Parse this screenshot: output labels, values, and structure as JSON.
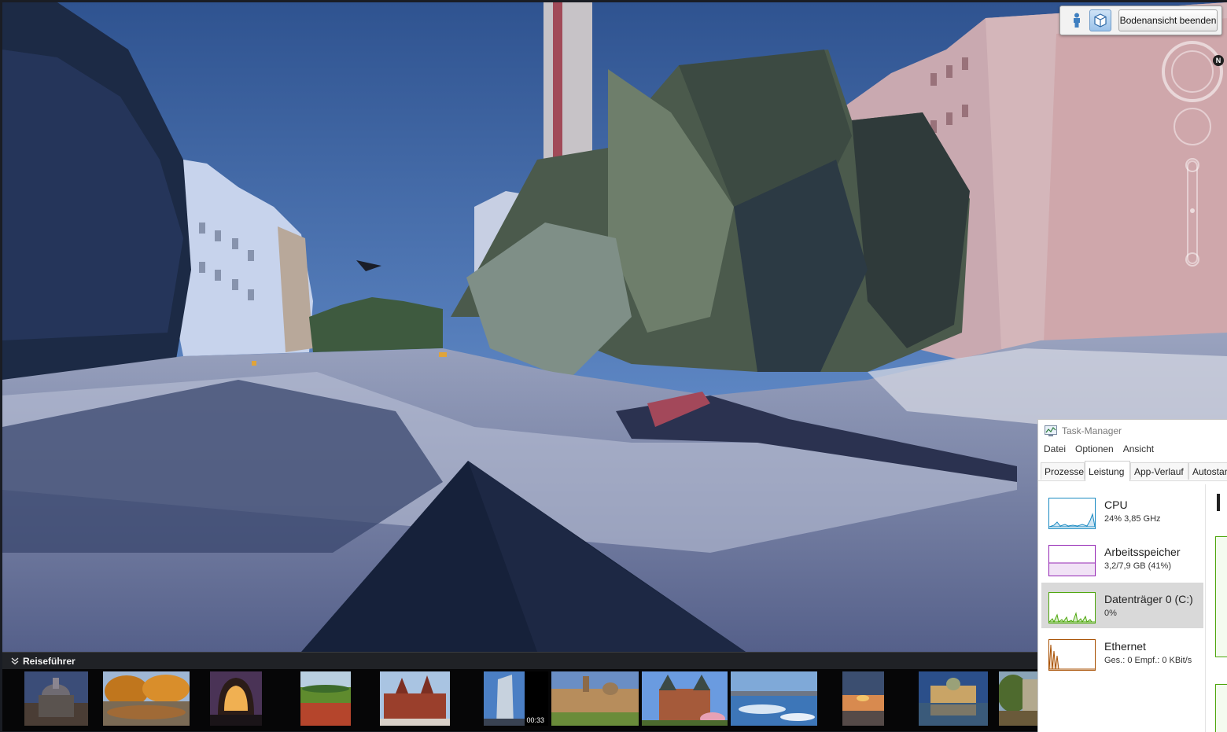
{
  "ground_view": {
    "exit_button": "Bodenansicht beenden",
    "person_icon": "person-icon",
    "cube_icon": "building-cube-icon",
    "compass_north": "N"
  },
  "guide": {
    "title": "Reiseführer",
    "toggle_icon": "double-chevron-down-icon",
    "thumbnails": [
      {
        "name": "dome-cathedral"
      },
      {
        "name": "autumn-park-pond"
      },
      {
        "name": "illuminated-dome-night"
      },
      {
        "name": "poppy-field"
      },
      {
        "name": "brick-gothic-building"
      },
      {
        "name": "skyscraper",
        "badge": "00:33"
      },
      {
        "name": "baroque-city-skyline"
      },
      {
        "name": "city-gate-towers"
      },
      {
        "name": "frozen-river-city"
      },
      {
        "name": "sunset-beach"
      },
      {
        "name": "town-hall-reflection"
      },
      {
        "name": "park-trees"
      }
    ]
  },
  "task_manager": {
    "title": "Task-Manager",
    "menu": [
      "Datei",
      "Optionen",
      "Ansicht"
    ],
    "tabs": [
      "Prozesse",
      "Leistung",
      "App-Verlauf",
      "Autostar"
    ],
    "active_tab": "Leistung",
    "items": [
      {
        "name": "CPU",
        "detail": "24% 3,85 GHz",
        "color": "#1a8ac2"
      },
      {
        "name": "Arbeitsspeicher",
        "detail": "3,2/7,9 GB (41%)",
        "color": "#9528b4"
      },
      {
        "name": "Datenträger 0 (C:)",
        "detail": "0%",
        "color": "#4da60c"
      },
      {
        "name": "Ethernet",
        "detail": "Ges.: 0 Empf.: 0 KBit/s",
        "color": "#a74f01"
      }
    ],
    "selected_item": "Datenträger 0 (C:)"
  }
}
